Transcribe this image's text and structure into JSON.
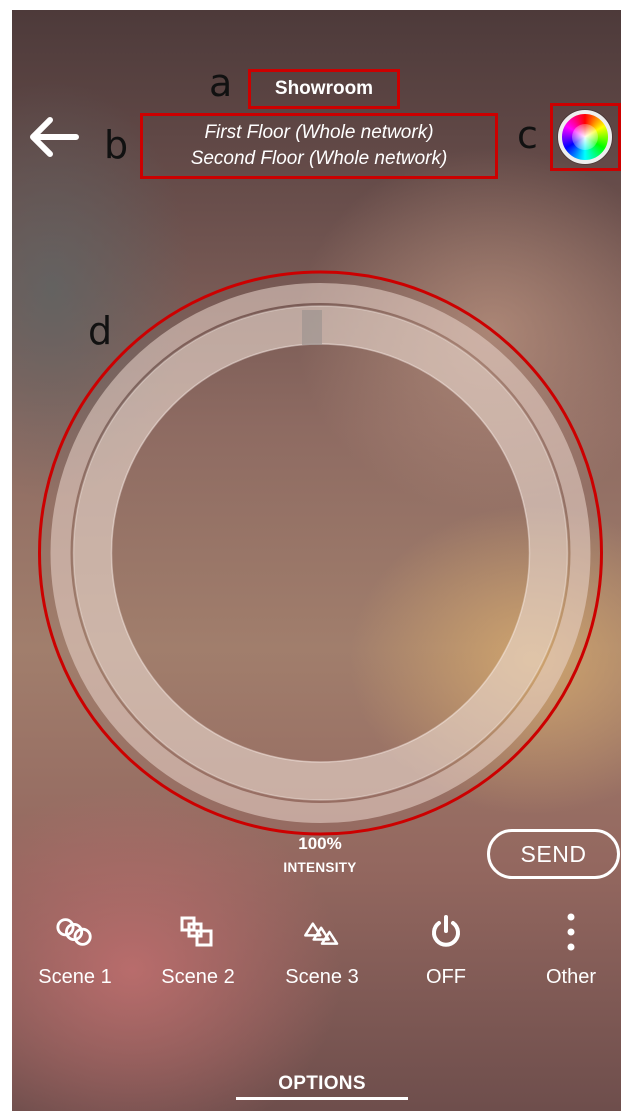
{
  "header": {
    "title": "Showroom",
    "subtitle_lines": [
      "First Floor (Whole network)",
      "Second Floor (Whole network)"
    ]
  },
  "annotations": {
    "a": "a",
    "b": "b",
    "c": "c",
    "d": "d"
  },
  "icons": {
    "back": "arrow-left-icon",
    "color": "color-wheel-icon",
    "scene1": "interlocking-circles-icon",
    "scene2": "overlapping-squares-icon",
    "scene3": "overlapping-triangles-icon",
    "off": "power-icon",
    "other": "vertical-dots-icon"
  },
  "intensity": {
    "value": "100%",
    "label": "INTENSITY",
    "level": 1.0
  },
  "send_label": "SEND",
  "options": [
    {
      "label": "Scene 1"
    },
    {
      "label": "Scene 2"
    },
    {
      "label": "Scene 3"
    },
    {
      "label": "OFF"
    },
    {
      "label": "Other"
    }
  ],
  "bottom_tab": "OPTIONS",
  "colors": {
    "annotation_box": "#cc0000",
    "text": "#ffffff"
  }
}
